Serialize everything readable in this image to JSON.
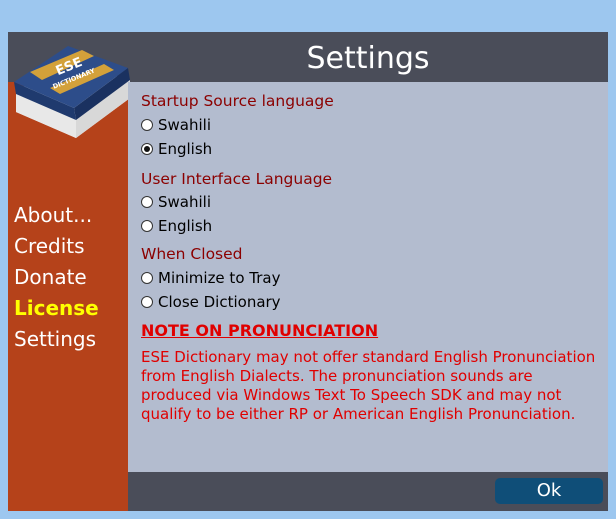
{
  "window": {
    "title": "Settings"
  },
  "logo": {
    "line1": "ESE",
    "line2": "DICTIONARY"
  },
  "sidebar": {
    "items": [
      {
        "label": "About..."
      },
      {
        "label": "Credits"
      },
      {
        "label": "Donate"
      },
      {
        "label": "License",
        "active": true
      },
      {
        "label": "Settings"
      }
    ]
  },
  "startup_source": {
    "label": "Startup Source language",
    "options": [
      "Swahili",
      "English"
    ],
    "selected": "English"
  },
  "ui_language": {
    "label": "User Interface Language",
    "options": [
      "Swahili",
      "English"
    ],
    "selected": null
  },
  "when_closed": {
    "label": "When Closed",
    "options": [
      "Minimize to Tray",
      "Close Dictionary"
    ],
    "selected": null
  },
  "note": {
    "heading": "NOTE ON PRONUNCIATION",
    "body": "ESE Dictionary may not offer standard English Pronunciation from English Dialects. The pronunciation sounds are produced via Windows Text To Speech SDK and may not qualify to be either RP or American English Pronunciation."
  },
  "buttons": {
    "ok": "Ok"
  },
  "colors": {
    "sidebar": "#b5421a",
    "active_nav": "#ffff00",
    "content_bg": "#b3bccf",
    "group_label": "#8b0000",
    "note_text": "#e00000",
    "ok_button": "#0f4e78"
  }
}
